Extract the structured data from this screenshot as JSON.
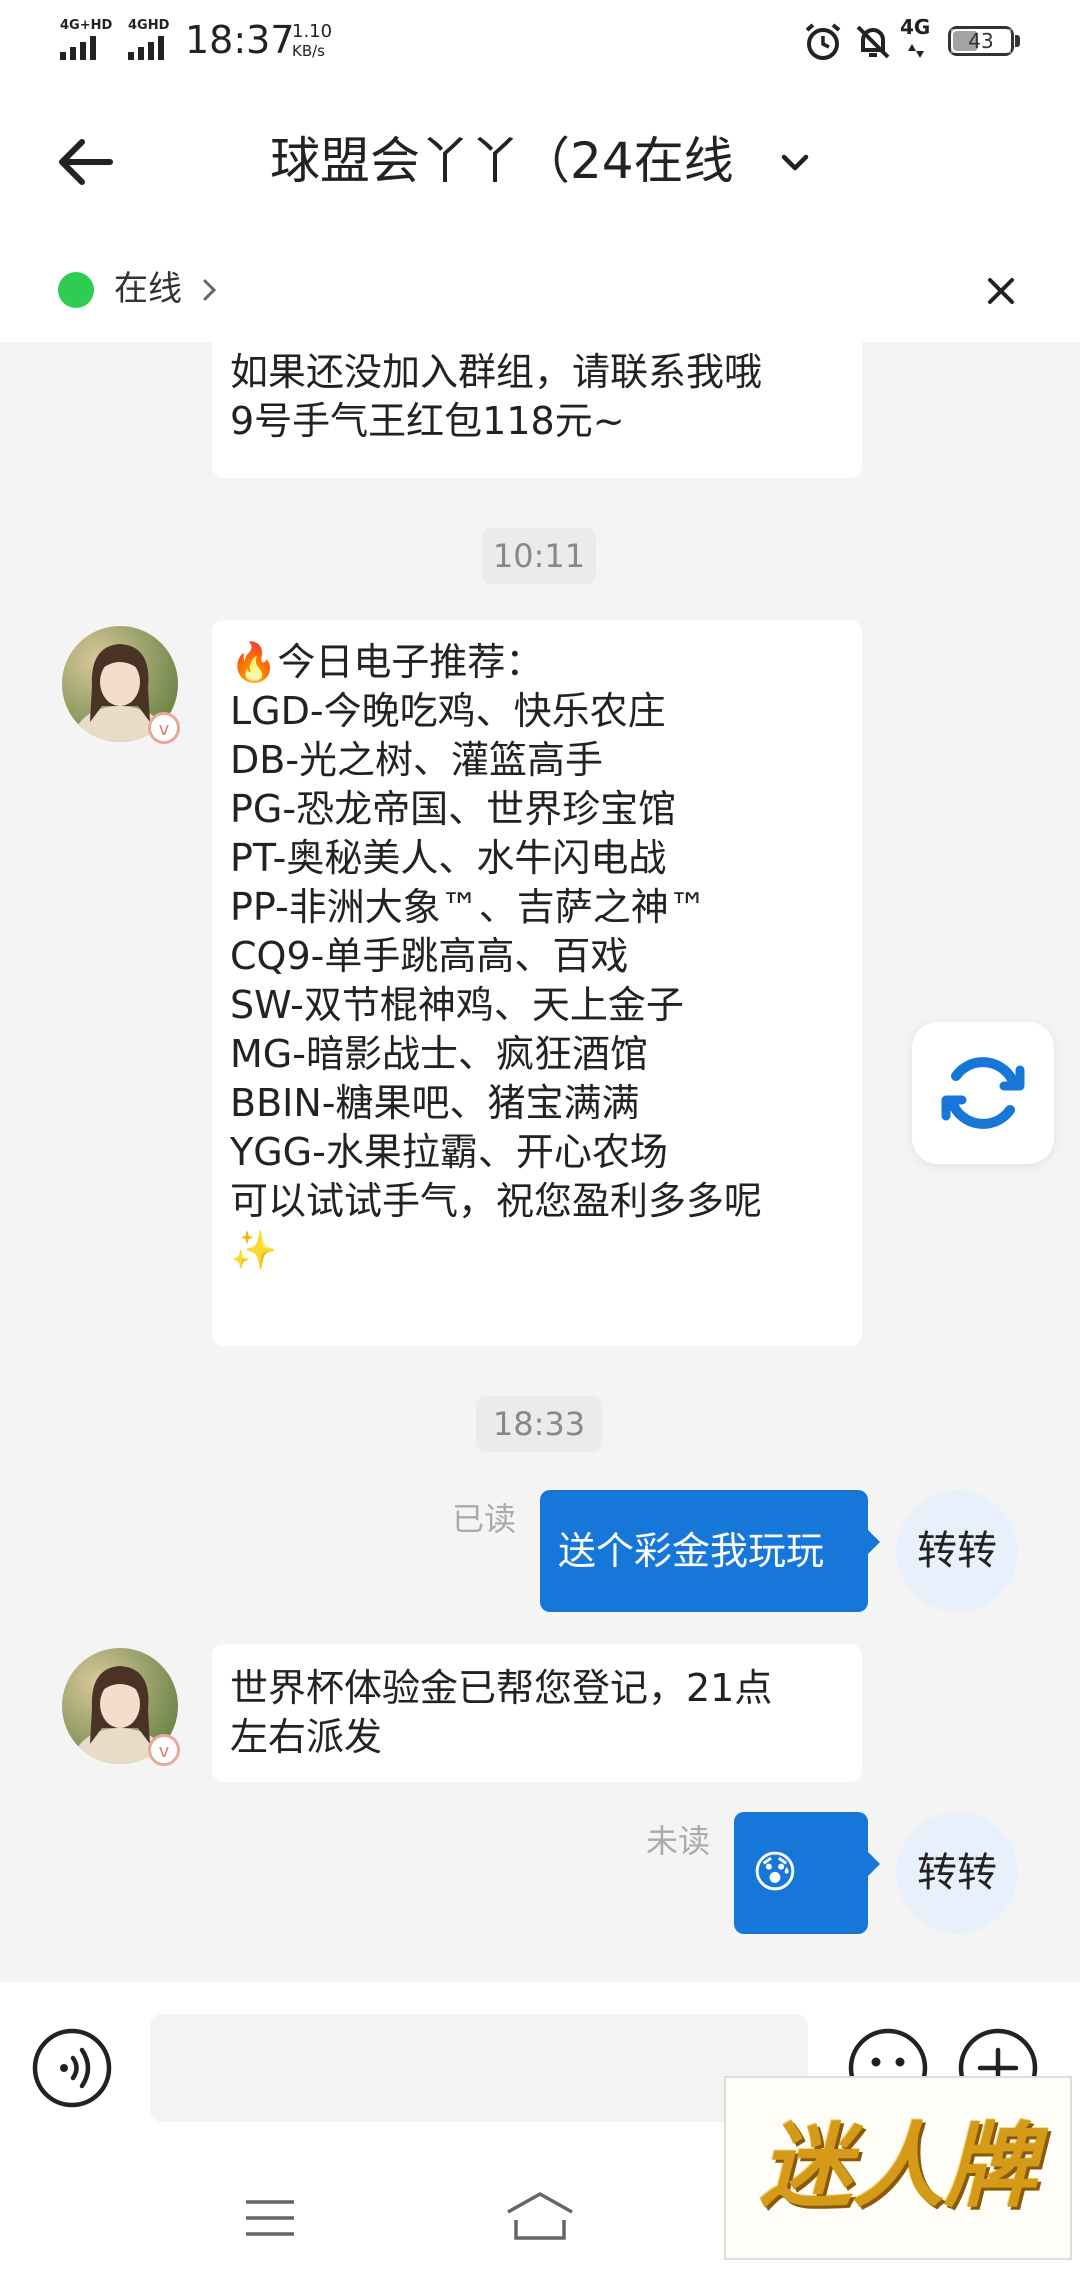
{
  "status_bar": {
    "signal1_label": "4G+HD",
    "signal2_label": "4GHD",
    "time": "18:37",
    "net_speed_value": "1.10",
    "net_speed_unit": "KB/s",
    "network_label": "4G",
    "battery": "43"
  },
  "header": {
    "title": "球盟会丫丫（24在线",
    "back_icon": "arrow-left-icon",
    "dropdown_icon": "chevron-down-icon"
  },
  "subbar": {
    "online_label": "在线",
    "online_color": "#2ecc55",
    "close_icon": "close-icon"
  },
  "messages": {
    "first_partial": [
      "如果还没加入群组，请联系我哦",
      "9号手气王红包118元~"
    ],
    "time1": "10:11",
    "rec_lines": [
      "🔥今日电子推荐：",
      "LGD-今晚吃鸡、快乐农庄",
      "DB-光之树、灌篮高手",
      "PG-恐龙帝国、世界珍宝馆",
      "PT-奥秘美人、水牛闪电战",
      "PP-非洲大象™、吉萨之神™",
      "CQ9-单手跳高高、百戏",
      "SW-双节棍神鸡、天上金子",
      "MG-暗影战士、疯狂酒馆",
      "BBIN-糖果吧、猪宝满满",
      "YGG-水果拉霸、开心农场",
      "可以试试手气，祝您盈利多多呢",
      "✨"
    ],
    "time2": "18:33",
    "sent1": {
      "status": "已读",
      "text": "送个彩金我玩玩",
      "sender": "转转"
    },
    "received2": [
      "世界杯体验金已帮您登记，21点",
      "左右派发"
    ],
    "sent2": {
      "status": "未读",
      "emoji": "😰",
      "sender": "转转"
    }
  },
  "floating": {
    "refresh_icon": "refresh-icon"
  },
  "input_bar": {
    "voice_icon": "voice-icon",
    "emoji_icon": "emoji-icon",
    "plus_icon": "plus-icon"
  },
  "nav_bar": {
    "menu_icon": "menu-icon",
    "home_icon": "home-icon"
  },
  "watermark": {
    "text": "迷人牌"
  },
  "colors": {
    "accent": "#1677d9",
    "background": "#f4f4f4",
    "bubble_left": "#ffffff"
  }
}
